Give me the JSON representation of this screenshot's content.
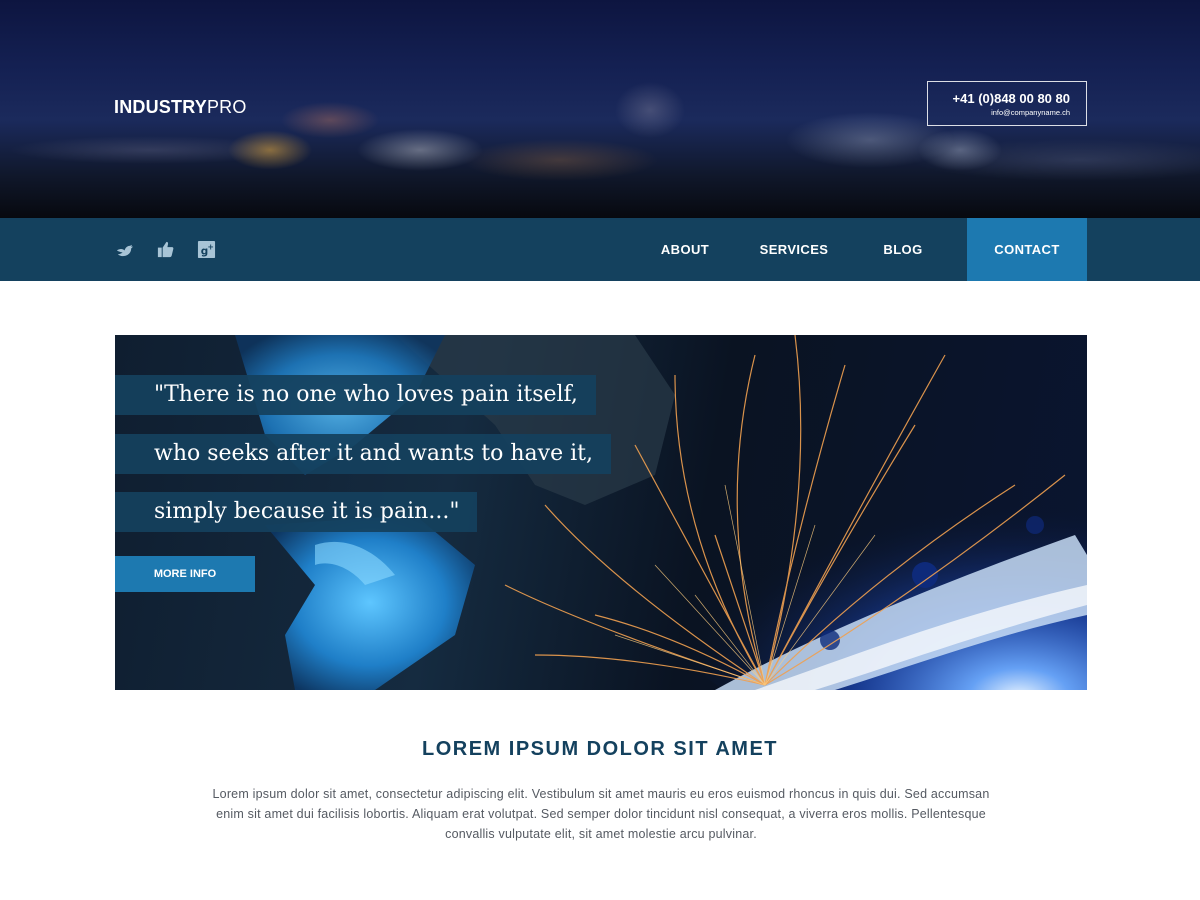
{
  "header": {
    "logo_bold": "INDUSTRY",
    "logo_light": "PRO",
    "phone": "+41 (0)848 00 80 80",
    "email": "info@companyname.ch"
  },
  "social": {
    "icons": [
      "twitter-icon",
      "thumbs-up-icon",
      "google-plus-icon"
    ]
  },
  "nav": {
    "items": [
      {
        "label": "ABOUT"
      },
      {
        "label": "SERVICES"
      },
      {
        "label": "BLOG"
      },
      {
        "label": "CONTACT",
        "active": true
      }
    ]
  },
  "hero": {
    "quote_lines": [
      "\"There is no one who loves pain itself,",
      "who seeks after it and wants to have it,",
      "simply because it is pain...\""
    ],
    "button_label": "MORE INFO"
  },
  "intro": {
    "title": "LOREM IPSUM DOLOR SIT AMET",
    "text": "Lorem ipsum dolor sit amet, consectetur adipiscing elit. Vestibulum sit amet mauris eu eros euismod rhoncus in quis dui. Sed accumsan enim sit amet dui facilisis lobortis. Aliquam erat volutpat. Sed semper dolor tincidunt nisl consequat, a viverra eros mollis. Pellentesque convallis vulputate elit, sit amet molestie arcu pulvinar."
  },
  "colors": {
    "nav_bg": "#14415e",
    "accent": "#1d79b0",
    "title": "#14415e",
    "body_text": "#555a62"
  }
}
